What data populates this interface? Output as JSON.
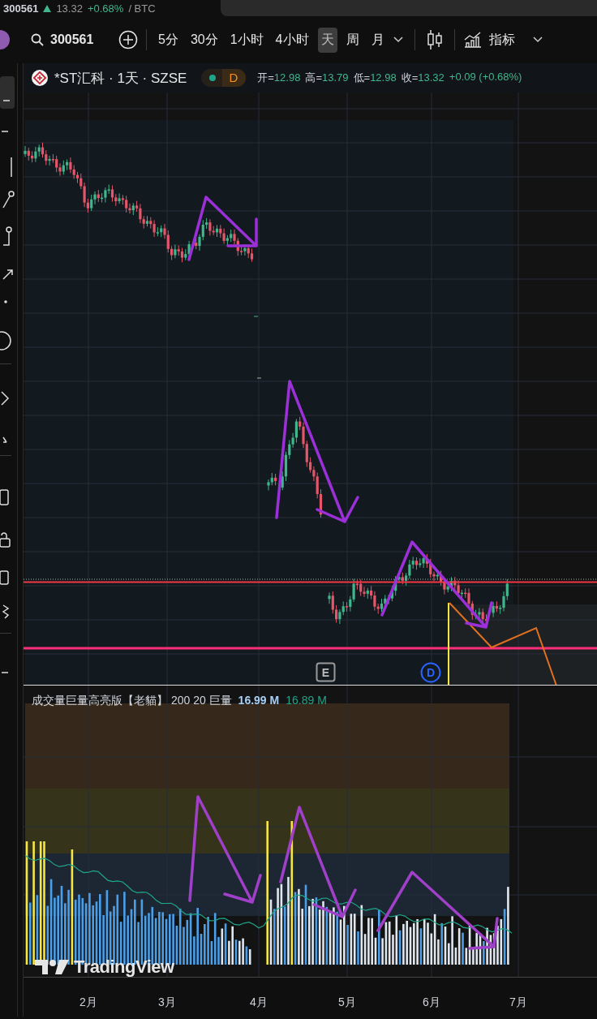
{
  "ticker_strip": {
    "symbol": "300561",
    "price": "13.32",
    "change": "+0.68%",
    "pair": "/ BTC"
  },
  "toolbar": {
    "search": "300561",
    "intervals": [
      {
        "label": "5分",
        "selected": false
      },
      {
        "label": "30分",
        "selected": false
      },
      {
        "label": "1小时",
        "selected": false
      },
      {
        "label": "4小时",
        "selected": false
      },
      {
        "label": "天",
        "selected": true
      },
      {
        "label": "周",
        "selected": false
      },
      {
        "label": "月",
        "selected": false
      }
    ],
    "indicators": "指标"
  },
  "legend": {
    "title": "*ST汇科 · 1天 · SZSE",
    "badge": "D",
    "ohlc": [
      {
        "label": "开=",
        "value": "12.98"
      },
      {
        "label": "高=",
        "value": "13.79"
      },
      {
        "label": "低=",
        "value": "12.98"
      },
      {
        "label": "收=",
        "value": "13.32"
      }
    ],
    "change": "+0.09 (+0.68%)"
  },
  "event_markers": [
    "E",
    "D"
  ],
  "volume": {
    "title": "成交量巨量高亮版【老貓】 200 20 巨量",
    "value_1": "16.99 M",
    "value_2": "16.89 M"
  },
  "logo_text": "TradingView",
  "time_axis": [
    "2月",
    "3月",
    "4月",
    "5月",
    "6月",
    "7月"
  ]
}
